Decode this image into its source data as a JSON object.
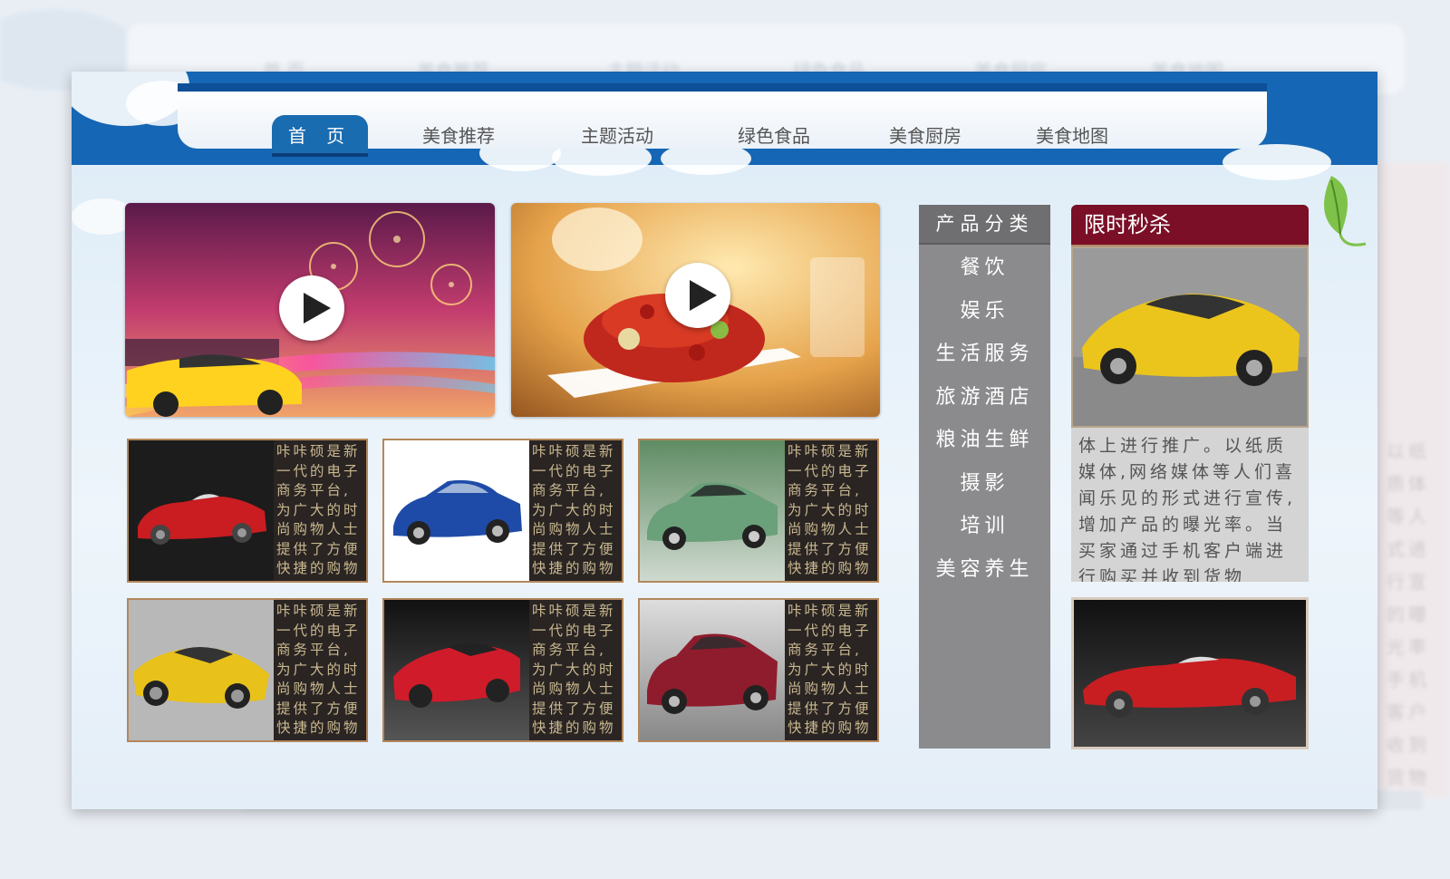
{
  "background": {
    "nav_items": [
      "首 页",
      "美食推荐",
      "主题活动",
      "绿色食品",
      "美食厨房",
      "美食地图"
    ],
    "side_text": "以纸质体等人式进行宣的曝光率手机客户收到货物"
  },
  "nav": {
    "items": [
      {
        "label": "首 页",
        "active": true
      },
      {
        "label": "美食推荐",
        "active": false
      },
      {
        "label": "主题活动",
        "active": false
      },
      {
        "label": "绿色食品",
        "active": false
      },
      {
        "label": "美食厨房",
        "active": false
      },
      {
        "label": "美食地图",
        "active": false
      }
    ]
  },
  "videos": [
    {
      "subject": "sports-car-fireworks",
      "icon": "play-icon"
    },
    {
      "subject": "crayfish-dish",
      "icon": "play-icon"
    }
  ],
  "products": [
    {
      "car": "red-roadster",
      "desc": "咔咔硕是新一代的电子商务平台,为广大的时尚购物人士提供了方便快捷的购物"
    },
    {
      "car": "blue-sedan",
      "desc": "咔咔硕是新一代的电子商务平台,为广大的时尚购物人士提供了方便快捷的购物"
    },
    {
      "car": "green-sedan",
      "desc": "咔咔硕是新一代的电子商务平台,为广大的时尚购物人士提供了方便快捷的购物"
    },
    {
      "car": "yellow-supercar",
      "desc": "咔咔硕是新一代的电子商务平台,为广大的时尚购物人士提供了方便快捷的购物"
    },
    {
      "car": "red-sports-coupe",
      "desc": "咔咔硕是新一代的电子商务平台,为广大的时尚购物人士提供了方便快捷的购物"
    },
    {
      "car": "maroon-sedan",
      "desc": "咔咔硕是新一代的电子商务平台,为广大的时尚购物人士提供了方便快捷的购物"
    }
  ],
  "category": {
    "title": "产品分类",
    "items": [
      "餐饮",
      "娱乐",
      "生活服务",
      "旅游酒店",
      "粮油生鲜",
      "摄影",
      "培训",
      "美容养生"
    ]
  },
  "flash_sale": {
    "title": "限时秒杀",
    "text": "体上进行推广。以纸质媒体,网络媒体等人们喜闻乐见的形式进行宣传,增加产品的曝光率。当买家通过手机客户端进行购买并收到货物"
  },
  "colors": {
    "header_blue": "#1566b4",
    "nav_active": "#1a6cb0",
    "category_gray": "#8b8b8d",
    "flash_red": "#7a0f27",
    "card_dark": "#2a2423",
    "card_text": "#c9b98f"
  }
}
